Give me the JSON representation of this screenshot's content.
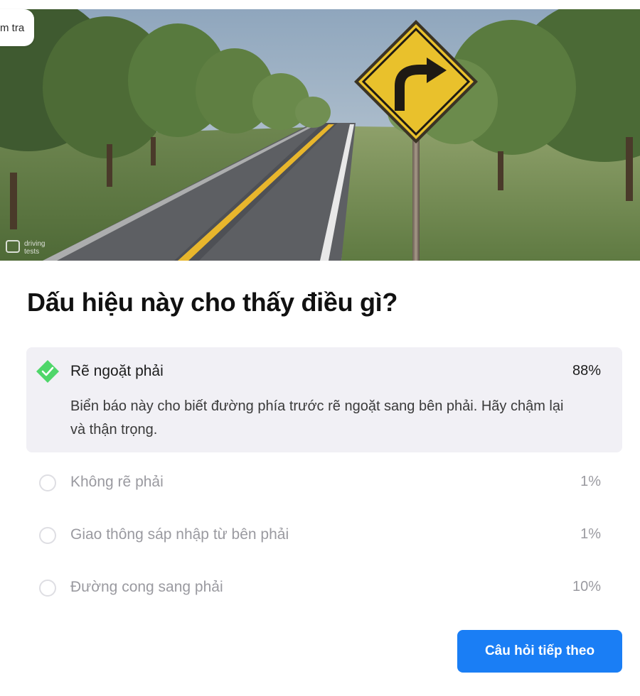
{
  "header": {
    "pill_text": "m tra"
  },
  "hero": {
    "watermark_line1": "driving",
    "watermark_line2": "tests"
  },
  "question": {
    "text": "Dấu hiệu này cho thấy điều gì?"
  },
  "answers": [
    {
      "label": "Rẽ ngoặt phải",
      "percent": "88%",
      "correct": true,
      "explanation": "Biển báo này cho biết đường phía trước rẽ ngoặt sang bên phải. Hãy chậm lại và thận trọng."
    },
    {
      "label": "Không rẽ phải",
      "percent": "1%",
      "correct": false
    },
    {
      "label": "Giao thông sáp nhập từ bên phải",
      "percent": "1%",
      "correct": false
    },
    {
      "label": "Đường cong sang phải",
      "percent": "10%",
      "correct": false
    }
  ],
  "next_button": {
    "label": "Câu hỏi tiếp theo"
  },
  "colors": {
    "accent": "#1a7ef5",
    "correct_green": "#4fd66a",
    "sign_yellow": "#e9c12c"
  },
  "icons": {
    "correct": "check-diamond-icon",
    "unselected": "radio-empty-icon",
    "sign": "right-turn-sign"
  }
}
